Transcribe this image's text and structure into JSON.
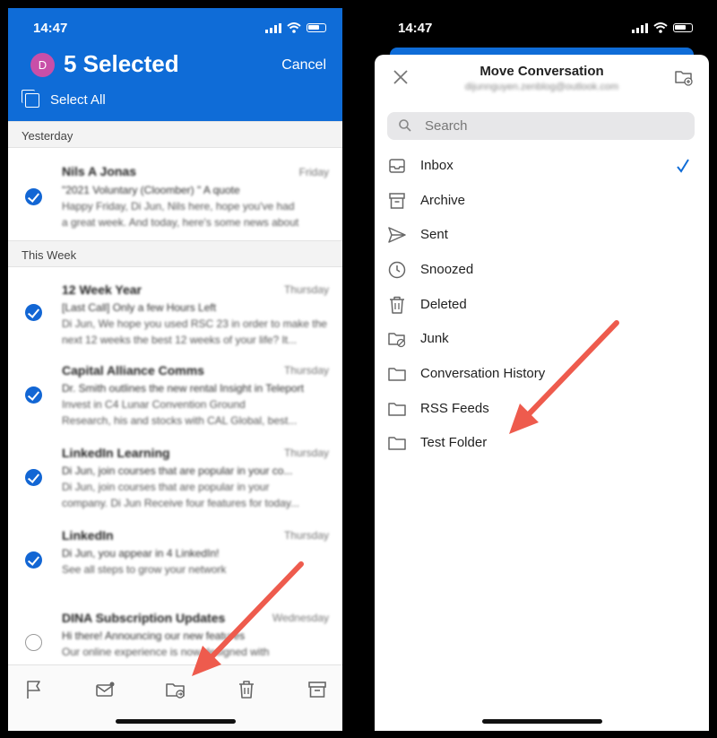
{
  "left": {
    "time": "14:47",
    "avatar_initial": "D",
    "selection_title": "5 Selected",
    "cancel_label": "Cancel",
    "select_all_label": "Select All",
    "sections": [
      "Yesterday",
      "This Week"
    ],
    "emails": [
      {
        "sender": "Nils A Jonas",
        "date": "Friday",
        "subject": "\"2021 Voluntary (Cloomber) \" A quote",
        "preview1": "Happy Friday, Di Jun, Nils here, hope you've had",
        "preview2": "a great week. And today, here's some news about",
        "selected": true
      },
      {
        "sender": "12 Week Year",
        "date": "Thursday",
        "subject": "[Last Call] Only a few Hours Left",
        "preview1": "Di Jun, We hope you used RSC 23 in order to make the",
        "preview2": "next 12 weeks the best 12 weeks of your life? It...",
        "selected": true
      },
      {
        "sender": "Capital Alliance Comms",
        "date": "Thursday",
        "subject": "Dr. Smith outlines the new rental Insight in Teleport",
        "preview1": "Invest in C4 Lunar Convention Ground",
        "preview2": "Research, his and stocks with CAL Global, best...",
        "selected": true
      },
      {
        "sender": "LinkedIn Learning",
        "date": "Thursday",
        "subject": "Di Jun, join courses that are popular in your co...",
        "preview1": "Di Jun, join courses that are popular in your",
        "preview2": "company. Di Jun Receive four features for today...",
        "selected": true
      },
      {
        "sender": "LinkedIn",
        "date": "Thursday",
        "subject": "Di Jun, you appear in 4 LinkedIn!",
        "preview1": "See all steps to grow your network",
        "preview2": "",
        "selected": true
      },
      {
        "sender": "DINA Subscription Updates",
        "date": "Wednesday",
        "subject": "Hi there! Announcing our new features",
        "preview1": "Our online experience is now designed with",
        "preview2": "",
        "selected": false
      }
    ]
  },
  "right": {
    "time": "14:47",
    "sheet_title": "Move Conversation",
    "account_email": "dijunnguyen.zenblog@outlook.com",
    "search_placeholder": "Search",
    "folders": [
      {
        "label": "Inbox",
        "icon": "inbox-icon",
        "checked": true
      },
      {
        "label": "Archive",
        "icon": "archive-icon",
        "checked": false
      },
      {
        "label": "Sent",
        "icon": "sent-icon",
        "checked": false
      },
      {
        "label": "Snoozed",
        "icon": "clock-icon",
        "checked": false
      },
      {
        "label": "Deleted",
        "icon": "trash-icon",
        "checked": false
      },
      {
        "label": "Junk",
        "icon": "junk-folder-icon",
        "checked": false
      },
      {
        "label": "Conversation History",
        "icon": "folder-icon",
        "checked": false
      },
      {
        "label": "RSS Feeds",
        "icon": "folder-icon",
        "checked": false
      },
      {
        "label": "Test Folder",
        "icon": "folder-icon",
        "checked": false
      }
    ]
  },
  "colors": {
    "accent": "#0f6cd7",
    "annotation_arrow": "#ee5b4d",
    "avatar": "#c84fa8"
  }
}
